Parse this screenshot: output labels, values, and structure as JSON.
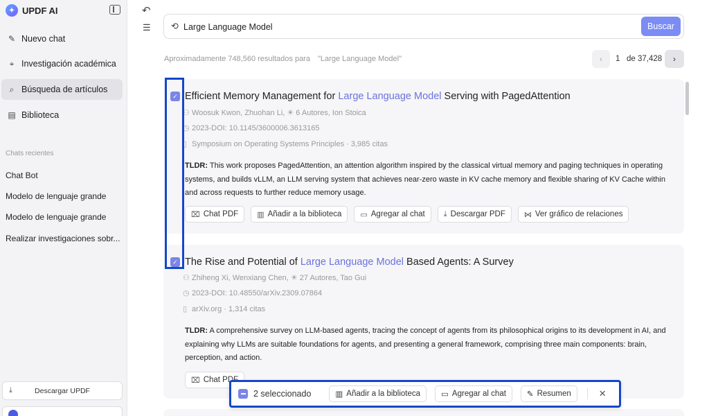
{
  "app": {
    "name": "UPDF AI"
  },
  "sidebar": {
    "items": [
      {
        "label": "Nuevo chat",
        "icon": "edit-icon"
      },
      {
        "label": "Investigación académica",
        "icon": "telescope-icon"
      },
      {
        "label": "Búsqueda de artículos",
        "icon": "search-doc-icon"
      },
      {
        "label": "Biblioteca",
        "icon": "library-icon"
      }
    ],
    "recent_title": "Chats recientes",
    "recent": [
      "Chat Bot",
      "Modelo de lenguaje grande",
      "Modelo de lenguaje grande",
      "Realizar investigaciones sobr..."
    ],
    "download_label": "Descargar UPDF"
  },
  "search": {
    "value": "Large Language Model",
    "button_label": "Buscar"
  },
  "results": {
    "info": "Aproximadamente 748,560 resultados para",
    "query": "\"Large Language Model\"",
    "page_current": "1",
    "page_total": "de 37,428"
  },
  "papers": [
    {
      "title_pre": "Efficient Memory Management for ",
      "title_hl": "Large Language Model",
      "title_post": " Serving with PagedAttention",
      "authors": "Woosuk Kwon, Zhuohan Li, ☀ 6 Autores, Ion Stoica",
      "doi": "2023-DOI: 10.1145/3600006.3613165",
      "venue": "Symposium on Operating Systems Principles · 3,985 citas",
      "tldr_label": "TLDR:",
      "tldr": " This work proposes PagedAttention, an attention algorithm inspired by the classical virtual memory and paging techniques in operating systems, and builds vLLM, an LLM serving system that achieves near-zero waste in KV cache memory and flexible sharing of KV Cache within and across requests to further reduce memory usage."
    },
    {
      "title_pre": "The Rise and Potential of ",
      "title_hl": "Large Language Model",
      "title_post": " Based Agents: A Survey",
      "authors": "Zhiheng Xi, Wenxiang Chen, ☀ 27 Autores, Tao Gui",
      "doi": "2023-DOI: 10.48550/arXiv.2309.07864",
      "venue": "arXiv.org · 1,314 citas",
      "tldr_label": "TLDR:",
      "tldr": " A comprehensive survey on LLM-based agents, tracing the concept of agents from its philosophical origins to its development in AI, and explaining why LLMs are suitable foundations for agents, and presenting a general framework, comprising three main components: brain, perception, and action."
    }
  ],
  "actions": {
    "chat_pdf": "Chat PDF",
    "add_library": "Añadir a la biblioteca",
    "add_chat": "Agregar al chat",
    "download_pdf": "Descargar PDF",
    "relations": "Ver gráfico de relaciones"
  },
  "selection": {
    "count": "2 seleccionado",
    "add_library": "Añadir a la biblioteca",
    "add_chat": "Agregar al chat",
    "summary": "Resumen"
  },
  "colors": {
    "accent": "#7b8cf4",
    "highlight_text": "#6a72de",
    "annotation_box": "#1447c9"
  }
}
